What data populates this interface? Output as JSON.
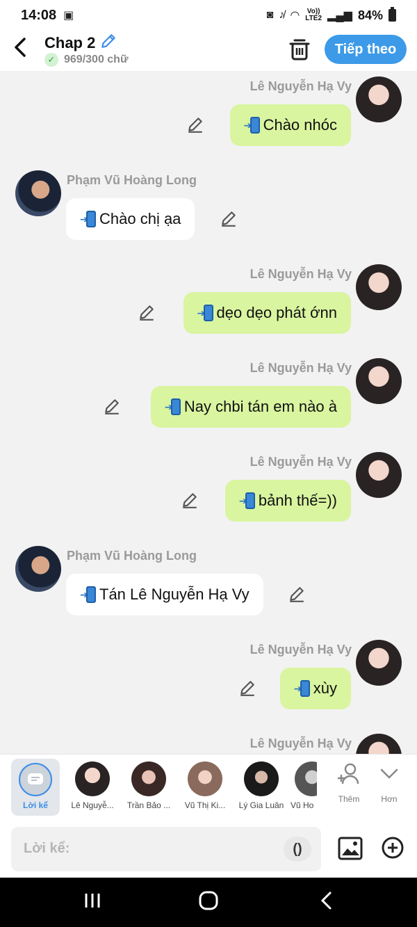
{
  "status": {
    "time": "14:08",
    "network": [
      "Vo))",
      "LTE2"
    ],
    "battery": "84%"
  },
  "header": {
    "title": "Chap 2",
    "word_count": "969/300 chữ",
    "next_label": "Tiếp theo"
  },
  "messages": [
    {
      "speaker": "Lê Nguyễn Hạ Vy",
      "text": "Chào nhóc",
      "side": "right"
    },
    {
      "speaker": "Phạm Vũ Hoàng Long",
      "text": "Chào chị ạa",
      "side": "left"
    },
    {
      "speaker": "Lê Nguyễn Hạ Vy",
      "text": "dẹo dẹo phát ớnn",
      "side": "right"
    },
    {
      "speaker": "Lê Nguyễn Hạ Vy",
      "text": "Nay chbi tán em nào à",
      "side": "right"
    },
    {
      "speaker": "Lê Nguyễn Hạ Vy",
      "text": "bảnh thế=))",
      "side": "right"
    },
    {
      "speaker": "Phạm Vũ Hoàng Long",
      "text": "Tán Lê Nguyễn Hạ Vy",
      "side": "left"
    },
    {
      "speaker": "Lê Nguyễn Hạ Vy",
      "text": "xùy",
      "side": "right"
    },
    {
      "speaker": "Lê Nguyễn Hạ Vy",
      "text": "",
      "side": "right"
    }
  ],
  "characters": [
    {
      "label": "Lời kể",
      "icon": "narrator-icon"
    },
    {
      "label": "Lê Nguyễ..."
    },
    {
      "label": "Trần Bảo ..."
    },
    {
      "label": "Vũ Thị Ki..."
    },
    {
      "label": "Lý Gia Luân"
    },
    {
      "label": "Vũ Ho"
    }
  ],
  "tools": {
    "add_label": "Thêm",
    "more_label": "Hơn"
  },
  "composer": {
    "placeholder": "Lời kể:",
    "paren": "()"
  }
}
